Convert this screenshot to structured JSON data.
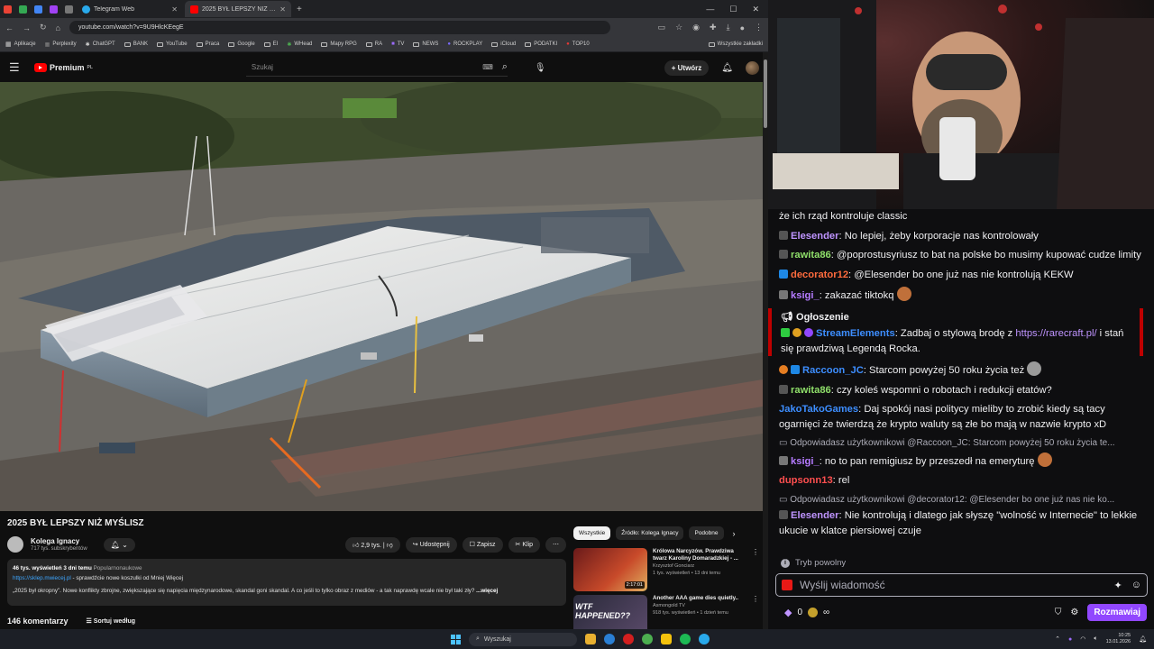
{
  "browser": {
    "tabs": [
      {
        "label": "Telegram Web",
        "active": false
      },
      {
        "label": "2025 BYŁ LEPSZY NIŻ MYŚLISZ",
        "active": true
      }
    ],
    "url": "youtube.com/watch?v=9U9HlcKEegE",
    "bookmarks": [
      "Aplikacje",
      "Perplexity",
      "ChatGPT",
      "BANK",
      "YouTube",
      "Praca",
      "Google",
      "EI",
      "WHead",
      "Mapy RPG",
      "RA",
      "TV",
      "NEWS",
      "ROCKPLAY",
      "iCloud",
      "PODATKI",
      "TOP10"
    ],
    "bookmarks_all": "Wszystkie zakładki"
  },
  "youtube": {
    "logo": "Premium",
    "logo_region": "PL",
    "search_placeholder": "Szukaj",
    "create_label": "Utwórz",
    "video": {
      "title": "2025 BYŁ LEPSZY NIŻ MYŚLISZ",
      "channel": "Kolega Ignacy",
      "subs": "717 tys. subskrybentów",
      "likes": "2,9 tys.",
      "share": "Udostępnij",
      "save": "Zapisz",
      "clip": "Klip",
      "views": "46 tys. wyświetleń",
      "age": "3 dni temu",
      "category": "Popularnonaukowe",
      "link": "https://sklep.mwiecej.pl",
      "link_text": " - sprawdźcie nowe koszulki od Mniej Więcej",
      "desc": "„2025 był okropny”. Nowe konflikty zbrojne, zwiększające się napięcia międzynarodowe, skandal goni skandal. A co jeśli to tylko obraz z mediów - a tak naprawdę wcale nie był taki zły?",
      "more": "...więcej",
      "comments": "146 komentarzy",
      "sort": "Sortuj według"
    },
    "filters": [
      "Wszystkie",
      "Źródło: Kolega Ignacy",
      "Podobne"
    ],
    "recommendations": [
      {
        "title": "Królowa Narcyzów. Prawdziwa twarz Karoliny Domaradzkiej - ...",
        "channel": "Krzysztof Gonciarz",
        "meta": "1 tys. wyświetleń • 13 dni temu",
        "duration": "2:17:01"
      },
      {
        "title": "Another AAA game dies quietly..",
        "channel": "Asmongold TV",
        "meta": "918 tys. wyświetleń • 1 dzień temu",
        "duration": "",
        "overlay": "WTF HAPPENED??"
      }
    ]
  },
  "chat": {
    "messages": [
      {
        "type": "text",
        "text": "że ich rząd kontroluje classic"
      },
      {
        "type": "msg",
        "user": "Elesender",
        "color": "#bf94ff",
        "text": ": No lepiej, żeby korporacje nas kontrolowały"
      },
      {
        "type": "msg",
        "user": "rawita86",
        "color": "#8fdf6a",
        "text": ": @poprostusyriusz to bat na polske bo musimy kupować cudze limity"
      },
      {
        "type": "msg",
        "user": "decorator12",
        "color": "#ff6b3d",
        "text": ": @Elesender bo one już nas nie kontrolują KEKW"
      },
      {
        "type": "msg",
        "user": "ksigi_",
        "color": "#b57bff",
        "text": ": zakazać tiktokq"
      }
    ],
    "announcement": {
      "title": "Ogłoszenie",
      "user": "StreamElements",
      "text_before": ": Zadbaj o stylową brodę z ",
      "link": "https://rarecraft.pl/",
      "text_after": " i stań się prawdziwą Legendą Rocka."
    },
    "messages2": [
      {
        "type": "msg",
        "user": "Raccoon_JC",
        "color": "#3d8eff",
        "text": ": Starcom powyżej 50 roku życia też"
      },
      {
        "type": "msg",
        "user": "rawita86",
        "color": "#8fdf6a",
        "text": ": czy koleś wspomni o robotach i redukcji etatów?"
      },
      {
        "type": "msg",
        "user": "JakoTakoGames",
        "color": "#3d8eff",
        "text": ": Daj spokój nasi politycy mieliby to zrobić kiedy są tacy ogarnięci że twierdzą że krypto waluty są złe bo mają w nazwie krypto xD"
      },
      {
        "type": "reply",
        "text": "Odpowiadasz użytkownikowi @Raccoon_JC: Starcom powyżej 50 roku życia te..."
      },
      {
        "type": "msg",
        "user": "ksigi_",
        "color": "#b57bff",
        "text": ": no to pan remigiusz by przeszedł na emeryturę"
      },
      {
        "type": "msg",
        "user": "dupsonn13",
        "color": "#ff4f4f",
        "text": ": rel"
      },
      {
        "type": "reply",
        "text": "Odpowiadasz użytkownikowi @decorator12: @Elesender bo one już nas nie ko..."
      },
      {
        "type": "msg",
        "user": "Elesender",
        "color": "#bf94ff",
        "text": ": Nie kontrolują i dlatego jak słyszę \"wolność w Internecie\" to lekkie ukucie w klatce piersiowej czuje"
      }
    ],
    "slow_mode": "Tryb powolny",
    "input_placeholder": "Wyślij wiadomość",
    "bits": "0",
    "send_label": "Rozmawiaj"
  },
  "taskbar": {
    "search": "Wyszukaj",
    "time": "10:25",
    "date": "13.01.2026"
  }
}
